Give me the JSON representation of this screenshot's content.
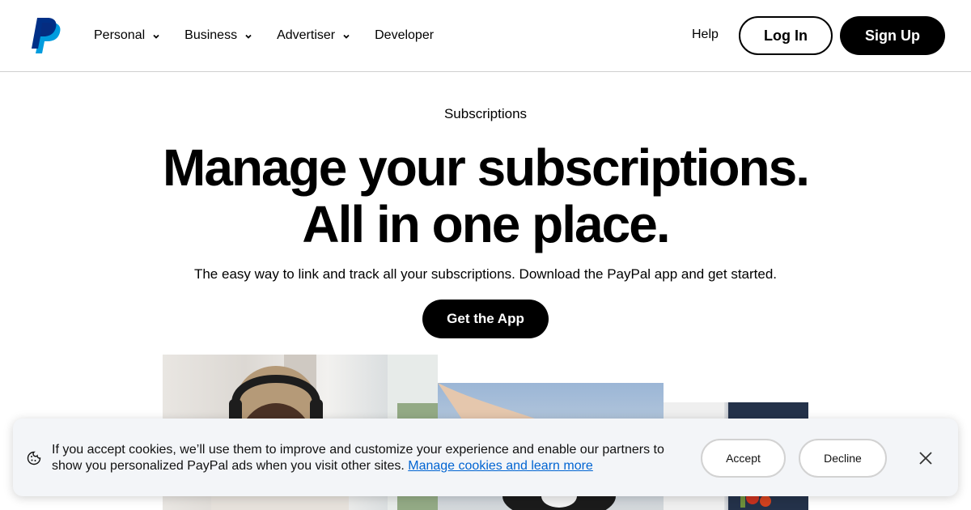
{
  "header": {
    "logo_icon": "paypal-logo",
    "nav": [
      {
        "label": "Personal",
        "has_dropdown": true
      },
      {
        "label": "Business",
        "has_dropdown": true
      },
      {
        "label": "Advertiser",
        "has_dropdown": true
      },
      {
        "label": "Developer",
        "has_dropdown": false
      }
    ],
    "help_label": "Help",
    "login_label": "Log In",
    "signup_label": "Sign Up"
  },
  "hero": {
    "eyebrow": "Subscriptions",
    "headline_line1": "Manage your subscriptions.",
    "headline_line2": "All in one place.",
    "subtext": "The easy way to link and track all your subscriptions. Download the PayPal app and get started.",
    "cta_label": "Get the App"
  },
  "cookie_banner": {
    "icon": "cookie-icon",
    "text": "If you accept cookies, we’ll use them to improve and customize your experience and enable our partners to show you personalized PayPal ads when you visit other sites.",
    "link_text": "Manage cookies and learn more",
    "accept_label": "Accept",
    "decline_label": "Decline",
    "close_icon": "close-icon"
  },
  "colors": {
    "brand_dark_blue": "#003087",
    "brand_light_blue": "#009cde",
    "link_blue": "#0064d2",
    "black": "#000000"
  }
}
